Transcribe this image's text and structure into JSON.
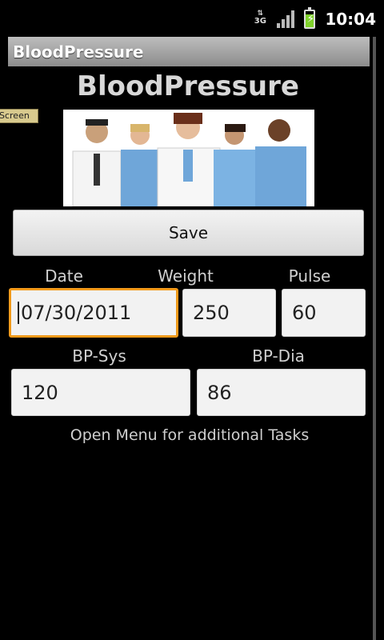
{
  "status_bar": {
    "network_label": "3G",
    "time": "10:04",
    "battery_level": 0.8,
    "icons": [
      "data-3g-icon",
      "signal-icon",
      "battery-charging-icon"
    ]
  },
  "window": {
    "title": "BloodPressure"
  },
  "main": {
    "heading": "BloodPressure",
    "screen_tag": "Screen",
    "save_label": "Save",
    "labels": {
      "date": "Date",
      "weight": "Weight",
      "pulse": "Pulse",
      "bp_sys": "BP-Sys",
      "bp_dia": "BP-Dia"
    },
    "values": {
      "date": "07/30/2011",
      "weight": "250",
      "pulse": "60",
      "bp_sys": "120",
      "bp_dia": "86"
    },
    "hint": "Open Menu for additional Tasks"
  },
  "colors": {
    "focus_border": "#f39a1a",
    "battery": "#7fd12b"
  }
}
